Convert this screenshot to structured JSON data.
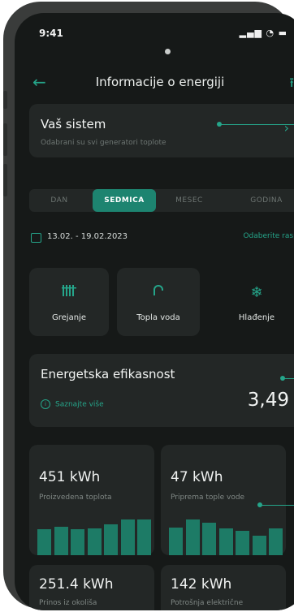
{
  "status_bar": {
    "time": "9:41",
    "indicators": "▂▄▆ ◔ ▬"
  },
  "header": {
    "back_icon": "←",
    "title": "Informacije o energiji",
    "share_icon": "⭱"
  },
  "system_card": {
    "title": "Vaš sistem",
    "subtitle": "Odabrani su svi generatori toplote",
    "chevron": "›"
  },
  "period_tabs": [
    {
      "label": "DAN",
      "active": false
    },
    {
      "label": "SEDMICA",
      "active": true
    },
    {
      "label": "MESEC",
      "active": false
    },
    {
      "label": "GODINA",
      "active": false
    }
  ],
  "date_row": {
    "range": "13.02. - 19.02.2023",
    "choose_range": "Odaberite raspon"
  },
  "modes": [
    {
      "icon": "radiator-icon",
      "glyph": "ⅡⅡIR",
      "label": "Grejanje"
    },
    {
      "icon": "faucet-icon",
      "glyph": "∩",
      "label": "Topla voda"
    },
    {
      "icon": "snowflake-icon",
      "glyph": "❄",
      "label": "Hlađenje"
    }
  ],
  "efficiency": {
    "title": "Energetska efikasnost",
    "info_icon": "i",
    "link": "Saznajte više",
    "value": "3,49"
  },
  "stats": [
    {
      "value": "451 kWh",
      "label": "Proizvedena toplota",
      "bars": [
        0.72,
        0.8,
        0.72,
        0.74,
        0.86,
        1.0,
        1.0
      ]
    },
    {
      "value": "47 kWh",
      "label": "Priprema tople vode",
      "bars": [
        0.78,
        1.0,
        0.9,
        0.75,
        0.68,
        0.55,
        0.74
      ]
    },
    {
      "value": "251.4 kWh",
      "label": "Prinos iz okoliša"
    },
    {
      "value": "142 kWh",
      "label": "Potrošnja električne"
    }
  ],
  "colors": {
    "accent": "#25a58a",
    "bar": "#1d7b66",
    "card": "#232726",
    "background": "#161918"
  }
}
